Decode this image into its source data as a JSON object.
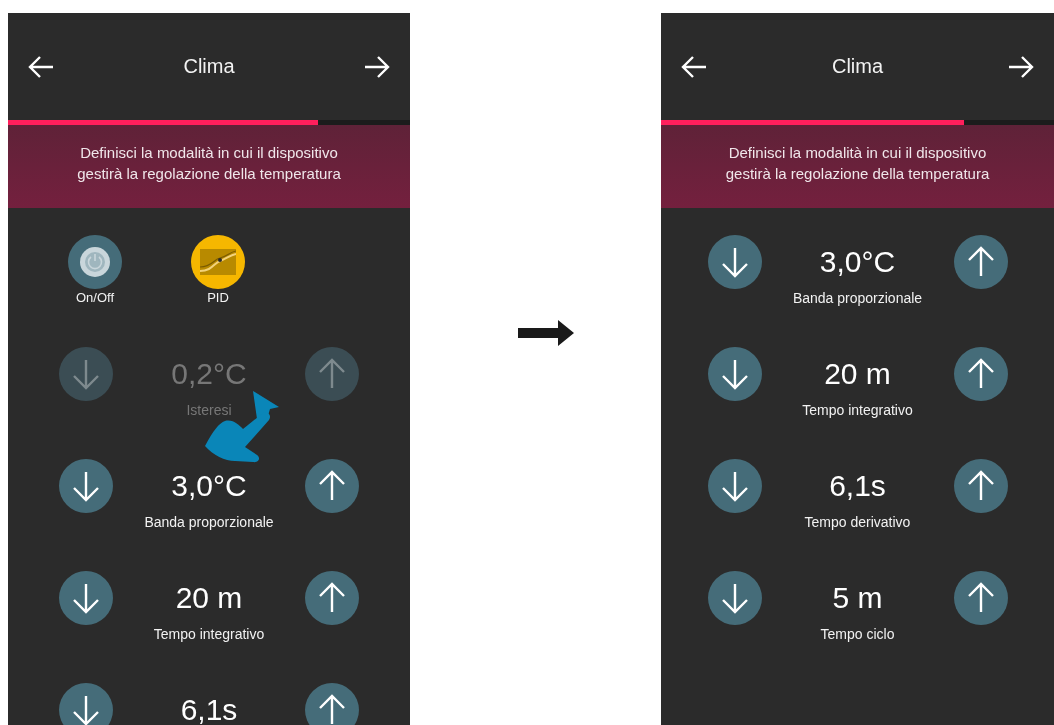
{
  "screens": [
    {
      "title": "Clima",
      "progress": {
        "level": 0.77
      },
      "banner": "Definisci la modalità in cui il dispositivo\ngestirà la regolazione della temperatura",
      "modes": [
        {
          "label": "On/Off",
          "kind": "power",
          "selected": false
        },
        {
          "label": "PID",
          "kind": "pid",
          "selected": true
        }
      ],
      "parameters": [
        {
          "value": "0,2°C",
          "label": "Isteresi",
          "disabled": true
        },
        {
          "value": "3,0°C",
          "label": "Banda proporzionale",
          "disabled": false
        },
        {
          "value": "20 m",
          "label": "Tempo integrativo",
          "disabled": false
        },
        {
          "value": "6,1s",
          "disabled": false
        }
      ]
    },
    {
      "title": "Clima",
      "progress": {
        "level": 0.77
      },
      "banner": "Definisci la modalità in cui il dispositivo\ngestirà la regolazione della temperatura",
      "parameters": [
        {
          "value": "3,0°C",
          "label": "Banda proporzionale",
          "disabled": false
        },
        {
          "value": "20 m",
          "label": "Tempo integrativo",
          "disabled": false
        },
        {
          "value": "6,1s",
          "label": "Tempo derivativo",
          "disabled": false
        },
        {
          "value": "5 m",
          "label": "Tempo ciclo",
          "disabled": false
        }
      ]
    }
  ]
}
